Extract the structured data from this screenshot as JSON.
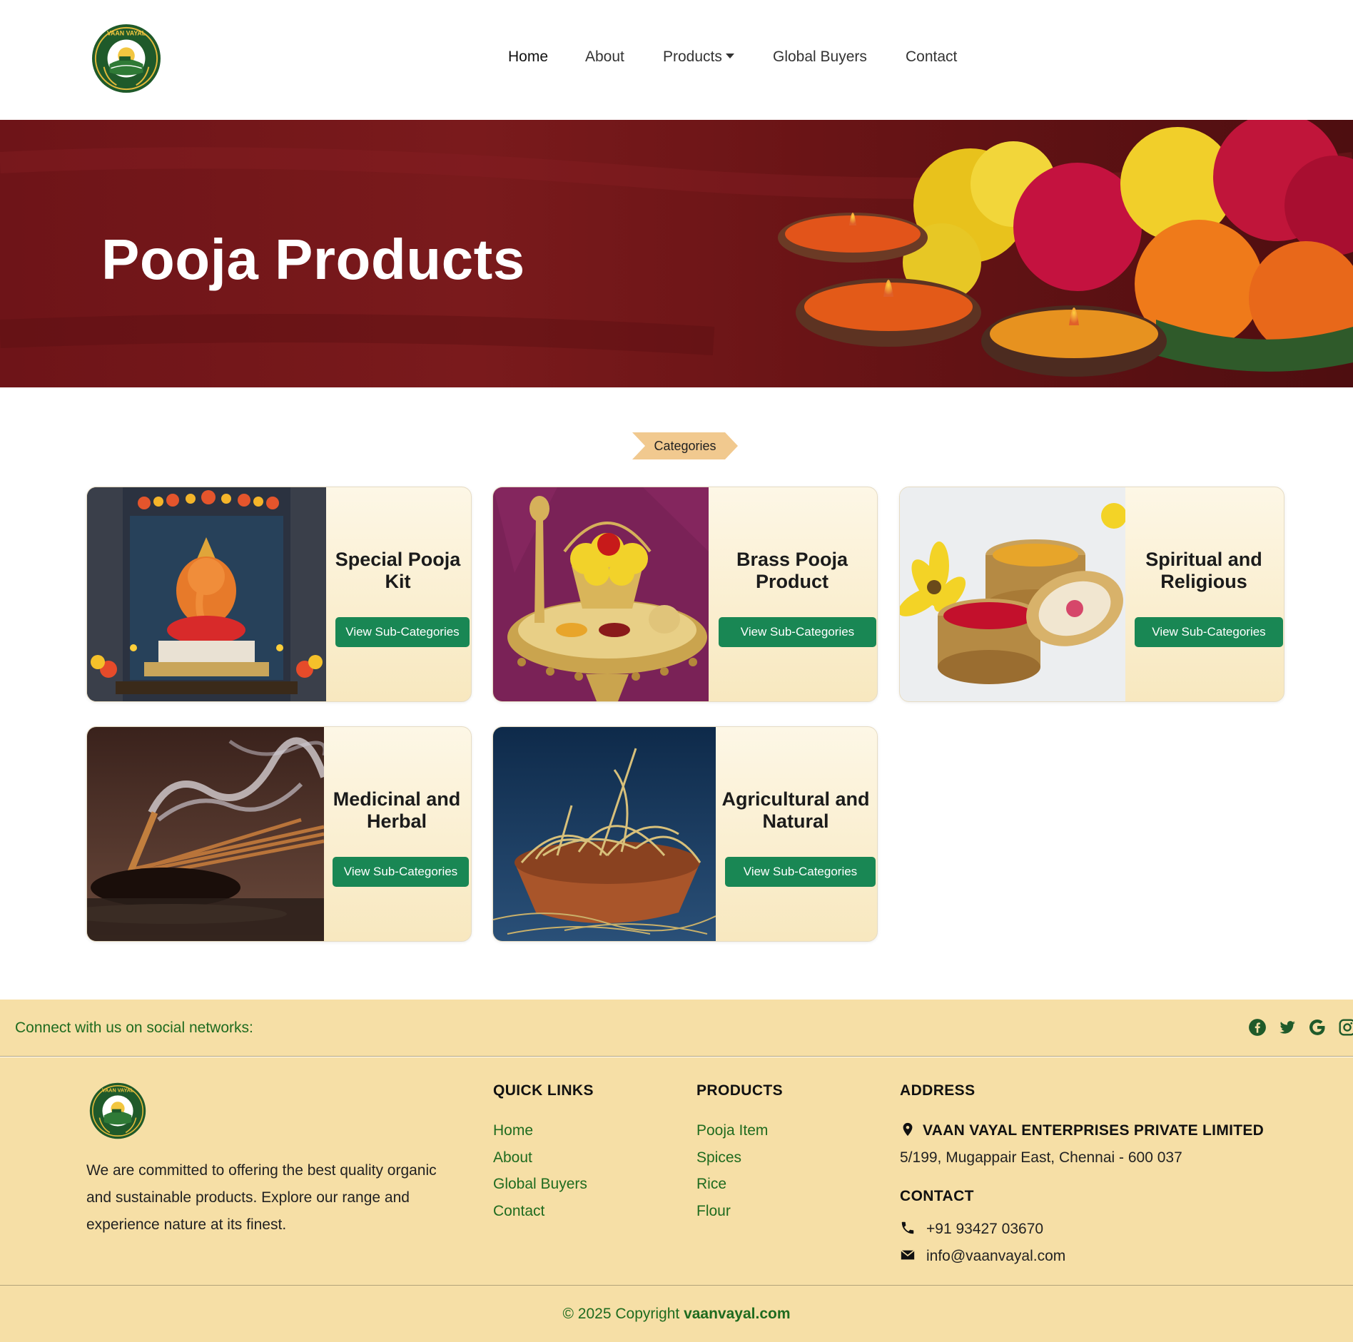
{
  "nav": {
    "logo_text": "VAAN VAYAL",
    "items": [
      {
        "label": "Home"
      },
      {
        "label": "About"
      },
      {
        "label": "Products"
      },
      {
        "label": "Global Buyers"
      },
      {
        "label": "Contact"
      }
    ]
  },
  "hero": {
    "title": "Pooja Products"
  },
  "categories": {
    "badge": "Categories",
    "button_label": "View Sub-Categories",
    "cards": [
      {
        "title": "Special Pooja Kit",
        "image": "ganesha-altar-image"
      },
      {
        "title": "Brass Pooja Product",
        "image": "brass-pooja-thali-image"
      },
      {
        "title": "Spiritual and Religious",
        "image": "kumkum-turmeric-image"
      },
      {
        "title": "Medicinal and Herbal",
        "image": "incense-sticks-image"
      },
      {
        "title": "Agricultural and Natural",
        "image": "vetiver-roots-image"
      }
    ]
  },
  "social": {
    "text": "Connect with us on social networks:",
    "icons": [
      "facebook-icon",
      "twitter-icon",
      "google-icon",
      "instagram-icon"
    ]
  },
  "footer": {
    "about": "We are committed to offering the best quality organic and sustainable products. Explore our range and experience nature at its finest.",
    "quick_links": {
      "heading": "QUICK LINKS",
      "items": [
        "Home",
        "About",
        "Global Buyers",
        "Contact"
      ]
    },
    "products": {
      "heading": "PRODUCTS",
      "items": [
        "Pooja Item",
        "Spices",
        "Rice",
        "Flour"
      ]
    },
    "address": {
      "heading": "ADDRESS",
      "company": "VAAN VAYAL ENTERPRISES PRIVATE LIMITED",
      "line": "5/199, Mugappair East, Chennai - 600 037"
    },
    "contact": {
      "heading": "CONTACT",
      "phone": "+91 93427 03670",
      "email": "info@vaanvayal.com"
    },
    "copyright_prefix": "© 2025 Copyright",
    "copyright_site": "vaanvayal.com"
  },
  "colors": {
    "accent_green": "#198754",
    "footer_bg": "#f6dfa6",
    "link_green": "#1f6b1f",
    "hero_bg": "#6e1418",
    "badge_bg": "#f1c98f"
  }
}
